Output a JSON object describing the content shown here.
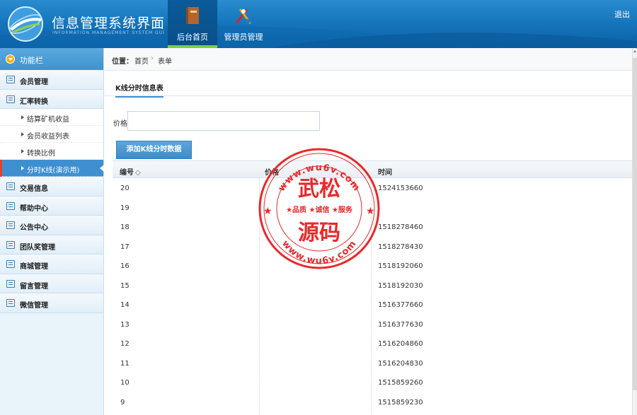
{
  "header": {
    "title": "信息管理系统界面",
    "subtitle": "INFORMATION MANAGEMENT SYSTEM GUI",
    "nav": [
      {
        "label": "后台首页",
        "icon": "book-icon",
        "active": true
      },
      {
        "label": "管理员管理",
        "icon": "tools-icon",
        "active": false
      }
    ],
    "logout": "退出"
  },
  "sidebar": {
    "head": "功能栏",
    "items": [
      {
        "label": "会员管理",
        "icon": "list-icon"
      },
      {
        "label": "汇率转换",
        "icon": "chat-icon"
      },
      {
        "label": "交易信息",
        "icon": "list-icon"
      },
      {
        "label": "帮助中心",
        "icon": "edit-icon"
      },
      {
        "label": "公告中心",
        "icon": "edit-icon"
      },
      {
        "label": "团队奖管理",
        "icon": "calendar-icon"
      },
      {
        "label": "商城管理",
        "icon": "calendar-icon"
      },
      {
        "label": "留言管理",
        "icon": "edit-icon"
      },
      {
        "label": "微信管理",
        "icon": "chat-icon"
      }
    ],
    "subitems": [
      {
        "label": "结算矿机收益"
      },
      {
        "label": "会员收益列表"
      },
      {
        "label": "转换比例"
      },
      {
        "label": "分时K线(演示用)",
        "active": true
      }
    ]
  },
  "breadcrumb": {
    "location_label": "位置：",
    "home": "首页",
    "separator": "›",
    "current": "表单"
  },
  "main": {
    "tab_title": "K线分时信息表",
    "price_label": "价格",
    "price_value": "",
    "add_button": "添加K线分时数据",
    "columns": [
      "编号",
      "价格",
      "时间"
    ],
    "sort_indicator": "◇",
    "rows": [
      {
        "id": "20",
        "price": "",
        "time": "1524153660"
      },
      {
        "id": "19",
        "price": "",
        "time": ""
      },
      {
        "id": "18",
        "price": "",
        "time": "1518278460"
      },
      {
        "id": "17",
        "price": "",
        "time": "1518278430"
      },
      {
        "id": "16",
        "price": "",
        "time": "1518192060"
      },
      {
        "id": "15",
        "price": "",
        "time": "1518192030"
      },
      {
        "id": "14",
        "price": "",
        "time": "1516377660"
      },
      {
        "id": "13",
        "price": "",
        "time": "1516377630"
      },
      {
        "id": "12",
        "price": "",
        "time": "1516204860"
      },
      {
        "id": "11",
        "price": "",
        "time": "1516204830"
      },
      {
        "id": "10",
        "price": "",
        "time": "1515859260"
      },
      {
        "id": "9",
        "price": "",
        "time": "1515859230"
      }
    ]
  },
  "watermark": {
    "url_top": "www.wu6v.com",
    "url_bottom": "www.wu6v.com",
    "name_top": "武松",
    "slogan": "★品质 ★诚信 ★服务",
    "name_bottom": "源码",
    "color": "#e8292b"
  },
  "colors": {
    "header_blue": "#1677bd",
    "accent_blue": "#3e8fd0",
    "active_green": "#7bd13a"
  }
}
